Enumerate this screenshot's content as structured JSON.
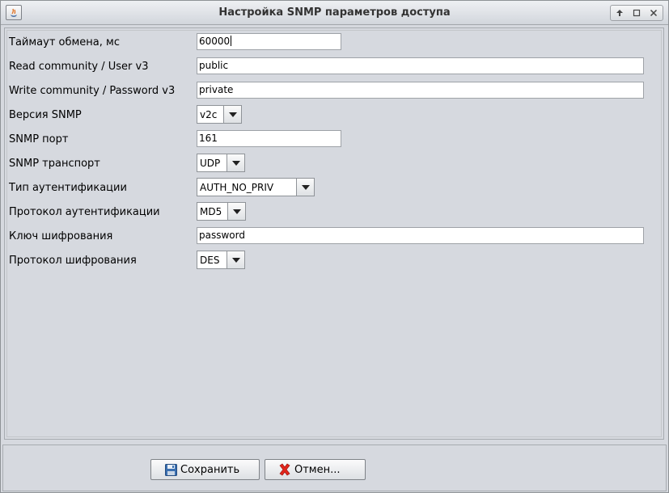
{
  "window": {
    "title": "Настройка SNMP параметров доступа"
  },
  "icons": {
    "app": "java-app-icon",
    "controls": [
      "up-arrow-icon",
      "maximize-icon",
      "close-icon"
    ],
    "save": "floppy-disk-icon",
    "cancel": "red-x-icon"
  },
  "form": {
    "timeout": {
      "label": "Таймаут обмена, мс",
      "value": "60000"
    },
    "read_community": {
      "label": "Read community / User v3",
      "value": "public"
    },
    "write_community": {
      "label": "Write community / Password v3",
      "value": "private"
    },
    "snmp_version": {
      "label": "Версия SNMP",
      "value": "v2c"
    },
    "snmp_port": {
      "label": "SNMP порт",
      "value": "161"
    },
    "snmp_transport": {
      "label": "SNMP транспорт",
      "value": "UDP"
    },
    "auth_type": {
      "label": "Тип аутентификации",
      "value": "AUTH_NO_PRIV"
    },
    "auth_protocol": {
      "label": "Протокол аутентификации",
      "value": "MD5"
    },
    "encryption_key": {
      "label": "Ключ шифрования",
      "value": "password"
    },
    "encryption_protocol": {
      "label": "Протокол шифрования",
      "value": "DES"
    }
  },
  "buttons": {
    "save": "Сохранить",
    "cancel": "Отмен..."
  },
  "colors": {
    "background": "#d6d9df",
    "cancel_icon": "#e3261c",
    "save_icon": "#3a6fb0"
  }
}
